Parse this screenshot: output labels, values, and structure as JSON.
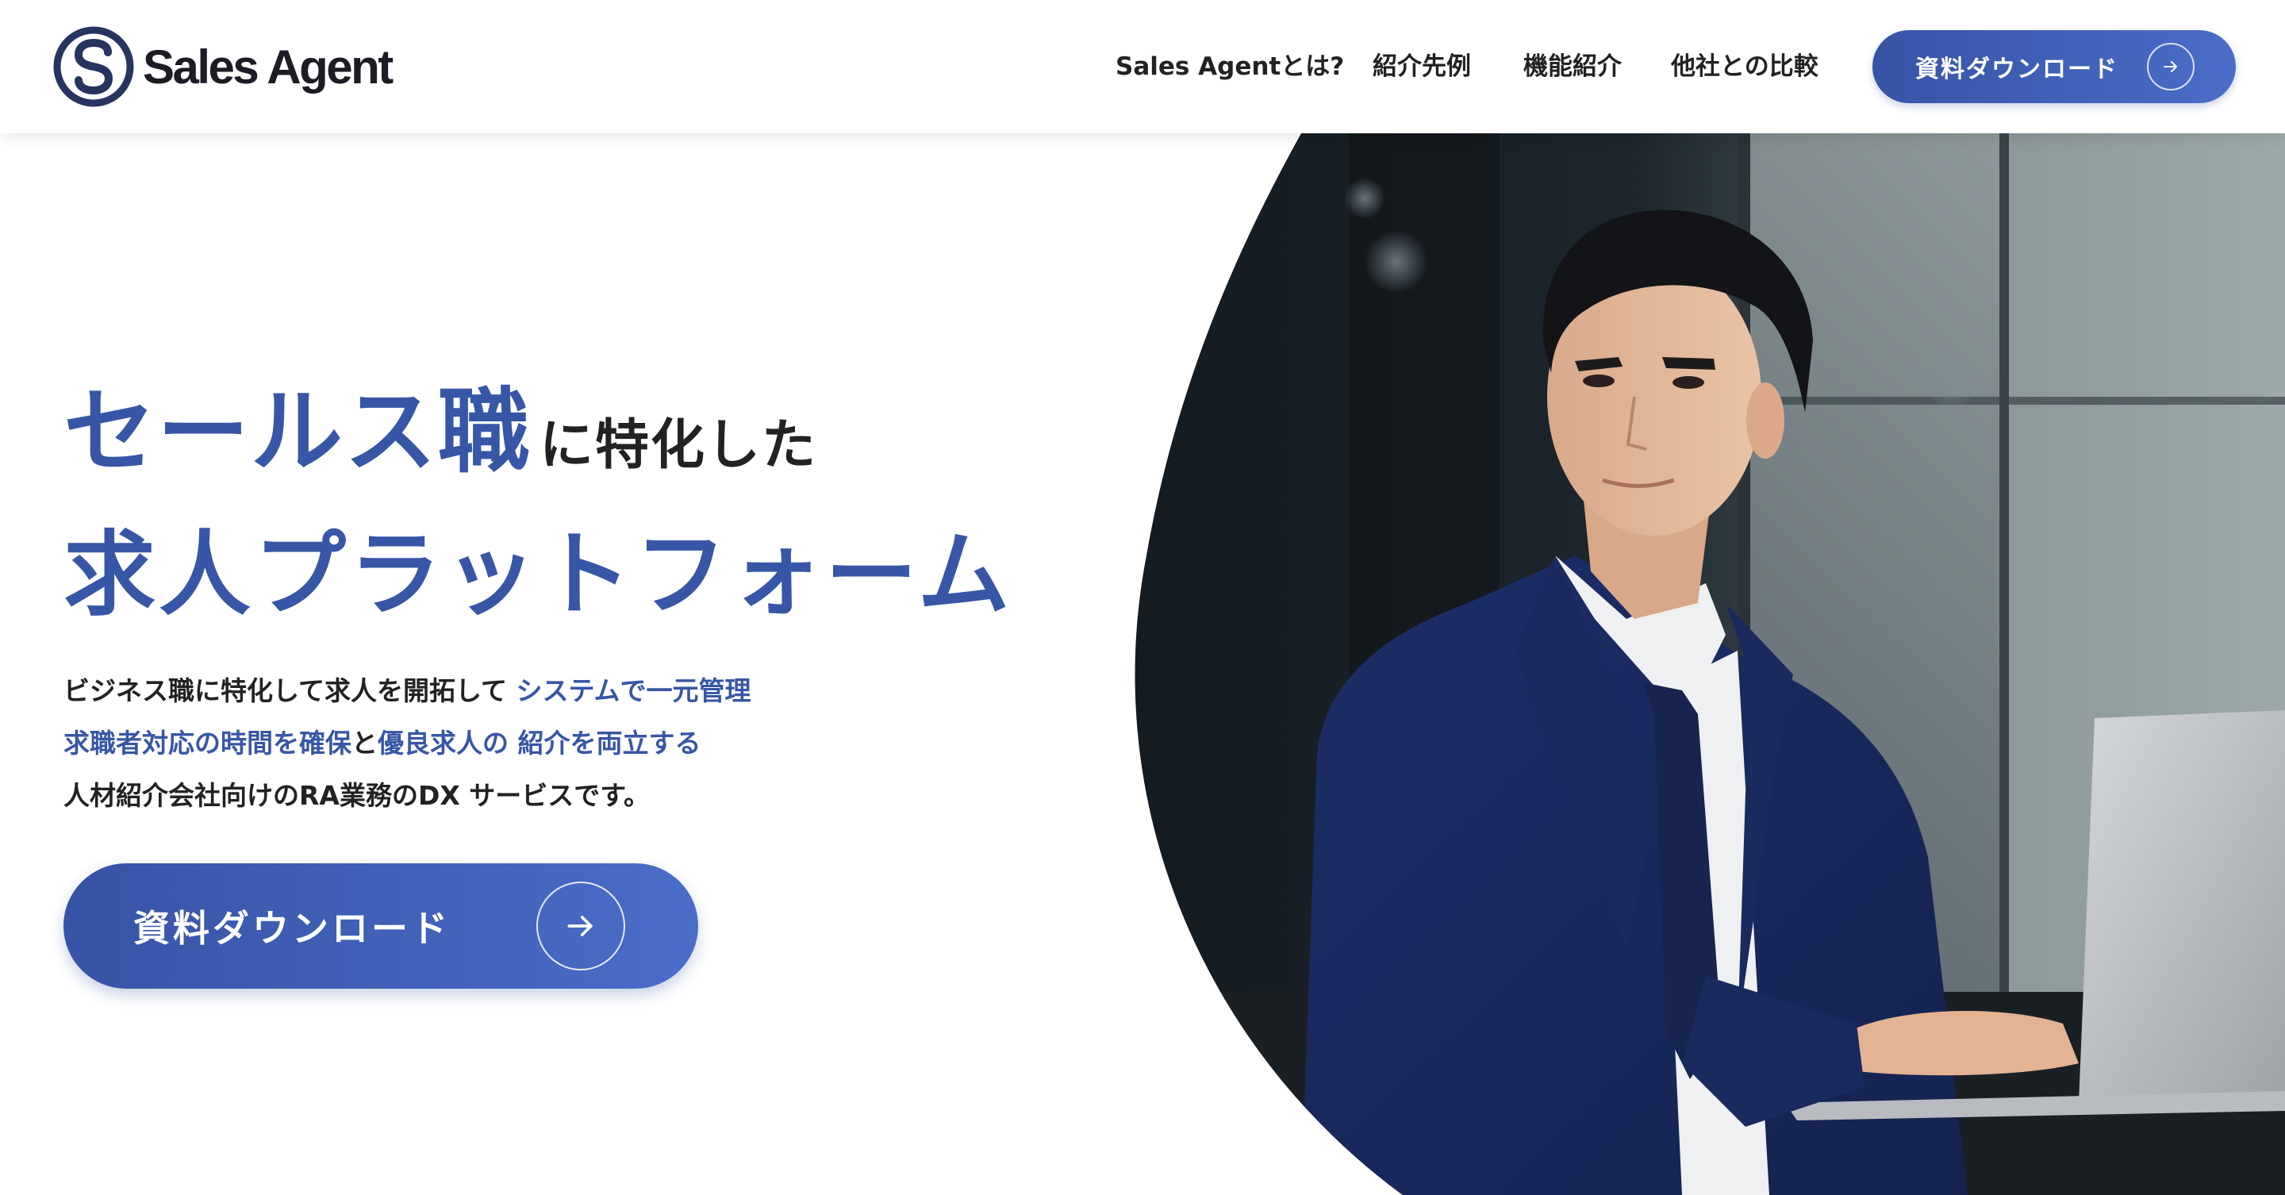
{
  "header": {
    "logo_text": "Sales Agent",
    "nav": [
      {
        "label": "Sales Agentとは?"
      },
      {
        "label": "紹介先例"
      },
      {
        "label": "機能紹介"
      },
      {
        "label": "他社との比較"
      }
    ],
    "cta_label": "資料ダウンロード"
  },
  "hero": {
    "headline_accent": "セールス職",
    "headline_suffix": "に特化した",
    "headline_line2": "求人プラットフォーム",
    "description": {
      "line1_dark": "ビジネス職に特化して求人を開拓して",
      "line1_blue": "システムで一元管理",
      "line2_blue_a": "求職者対応の時間を確保",
      "line2_dark": "と",
      "line2_blue_b": "優良求人の 紹介を両立する",
      "line3": "人材紹介会社向けのRA業務のDX サービスです。"
    },
    "cta_label": "資料ダウンロード",
    "image": "businessman-with-laptop-photo"
  },
  "colors": {
    "accent": "#3756a6",
    "button_gradient_start": "#3853a5",
    "button_gradient_end": "#4a6dc9",
    "text": "#222222",
    "background": "#ffffff"
  },
  "icons": {
    "logo": "s-circle-logo-icon",
    "button_arrow": "arrow-right-icon"
  }
}
